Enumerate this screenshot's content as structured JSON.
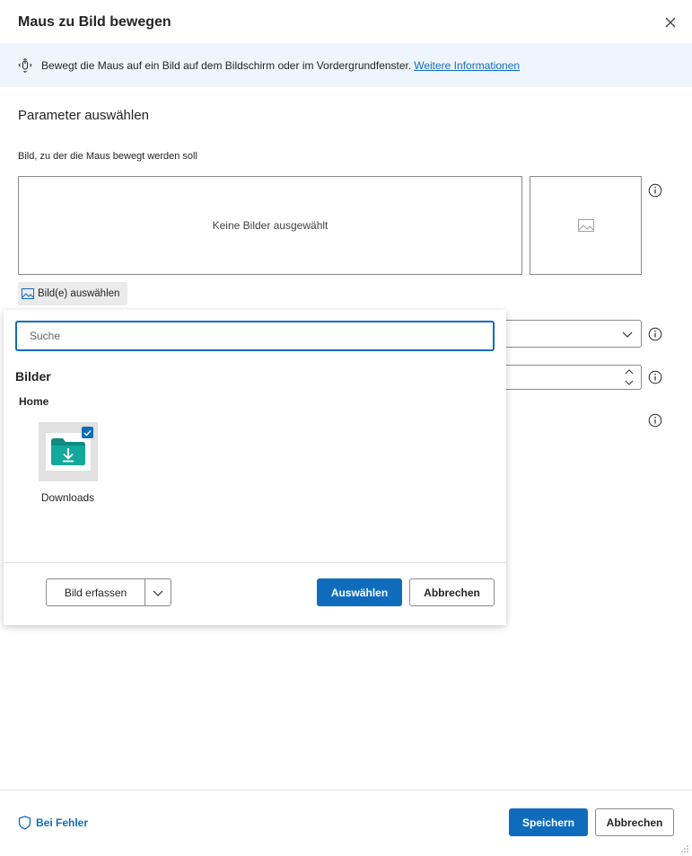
{
  "dialog": {
    "title": "Maus zu Bild bewegen",
    "close_icon": "close-icon"
  },
  "info_bar": {
    "icon": "mouse-move-icon",
    "text": "Bewegt die Maus auf ein Bild auf dem Bildschirm oder im Vordergrundfenster.",
    "link": "Weitere Informationen"
  },
  "parameters": {
    "section_title": "Parameter auswählen",
    "image_field": {
      "label": "Bild, zu der die Maus bewegt werden soll",
      "empty_text": "Keine Bilder ausgewählt",
      "select_button": "Bild(e) auswählen"
    }
  },
  "picker": {
    "search_placeholder": "Suche",
    "heading": "Bilder",
    "group": "Home",
    "items": [
      {
        "label": "Downloads",
        "checked": true
      }
    ],
    "capture_button": "Bild erfassen",
    "select_button": "Auswählen",
    "cancel_button": "Abbrechen"
  },
  "footer": {
    "on_error": "Bei Fehler",
    "save_button": "Speichern",
    "cancel_button": "Abbrechen"
  },
  "colors": {
    "accent": "#0f6cbd",
    "info_bg": "#eff5fd",
    "folder_teal": "#13a89e"
  }
}
